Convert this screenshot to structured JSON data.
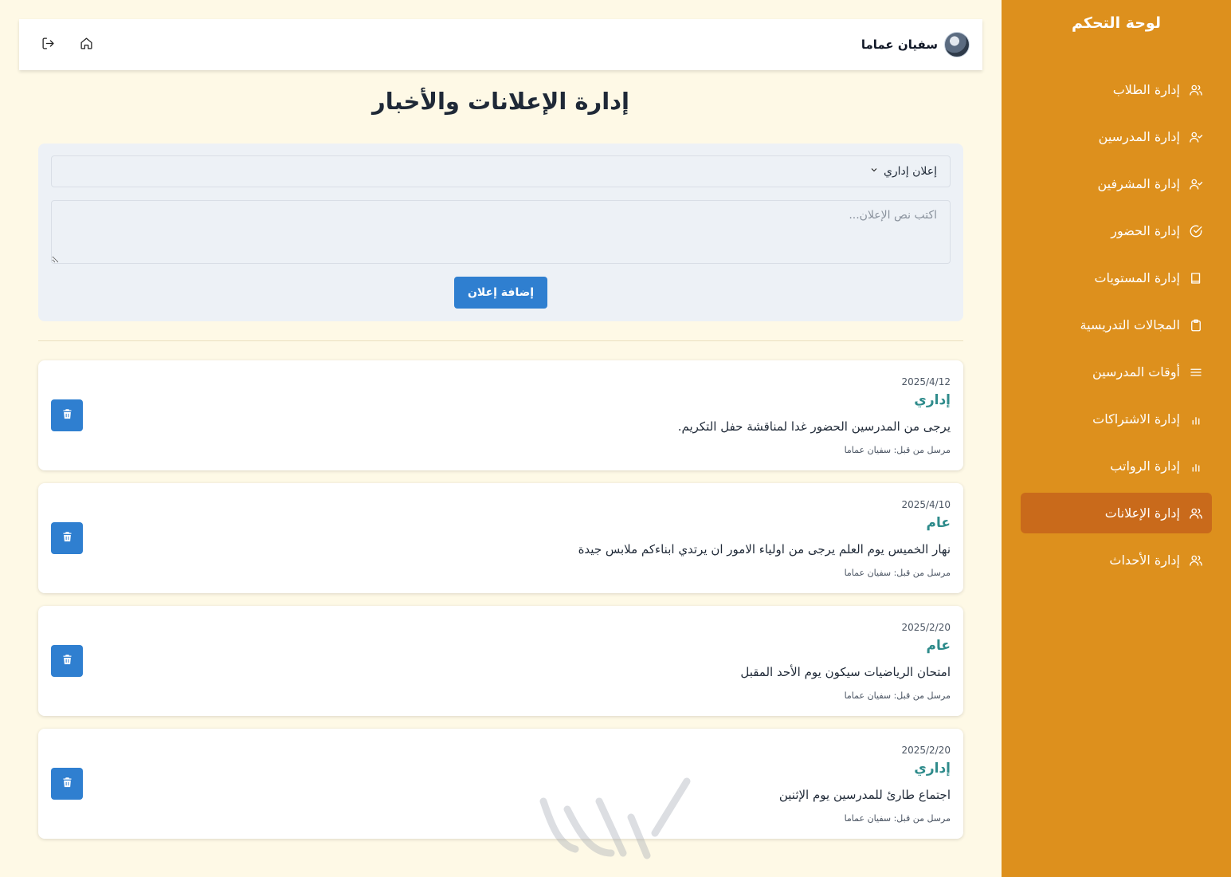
{
  "sidebar": {
    "title": "لوحة التحكم",
    "items": [
      {
        "label": "إدارة الطلاب",
        "icon": "users-icon",
        "active": false
      },
      {
        "label": "إدارة المدرسين",
        "icon": "user-check-icon",
        "active": false
      },
      {
        "label": "إدارة المشرفين",
        "icon": "user-check-icon",
        "active": false
      },
      {
        "label": "إدارة الحضور",
        "icon": "check-circle-icon",
        "active": false
      },
      {
        "label": "إدارة المستويات",
        "icon": "book-icon",
        "active": false
      },
      {
        "label": "المجالات التدريسية",
        "icon": "clipboard-icon",
        "active": false
      },
      {
        "label": "أوقات المدرسين",
        "icon": "menu-icon",
        "active": false
      },
      {
        "label": "إدارة الاشتراكات",
        "icon": "bar-chart-icon",
        "active": false
      },
      {
        "label": "إدارة الرواتب",
        "icon": "bar-chart-icon",
        "active": false
      },
      {
        "label": "إدارة الإعلانات",
        "icon": "users-icon",
        "active": true
      },
      {
        "label": "إدارة الأحداث",
        "icon": "users-icon",
        "active": false
      }
    ]
  },
  "header": {
    "user_name": "سفيان عماما",
    "home_icon": "home-icon",
    "logout_icon": "logout-icon"
  },
  "page": {
    "title": "إدارة الإعلانات والأخبار"
  },
  "form": {
    "type_selected": "إعلان إداري",
    "text_placeholder": "اكتب نص الإعلان...",
    "text_value": "",
    "submit_label": "إضافة إعلان"
  },
  "announcements": [
    {
      "date": "2025/4/12",
      "type": "إداري",
      "text": "يرجى من المدرسين الحضور غدا لمناقشة حفل التكريم.",
      "sender": "مرسل من قبل: سفيان عماما"
    },
    {
      "date": "2025/4/10",
      "type": "عام",
      "text": "نهار الخميس يوم العلم يرجى من اولياء الامور ان يرتدي ابناءكم ملابس جيدة",
      "sender": "مرسل من قبل: سفيان عماما"
    },
    {
      "date": "2025/2/20",
      "type": "عام",
      "text": "امتحان الرياضيات سيكون يوم الأحد المقبل",
      "sender": "مرسل من قبل: سفيان عماما"
    },
    {
      "date": "2025/2/20",
      "type": "إداري",
      "text": "اجتماع طارئ للمدرسين يوم الإثنين",
      "sender": "مرسل من قبل: سفيان عماما"
    }
  ],
  "colors": {
    "sidebar_bg": "#dd901d",
    "sidebar_active": "#c96a1b",
    "page_bg": "#fef9e6",
    "primary": "#2f7fd0",
    "type_label": "#2e8b8b"
  }
}
